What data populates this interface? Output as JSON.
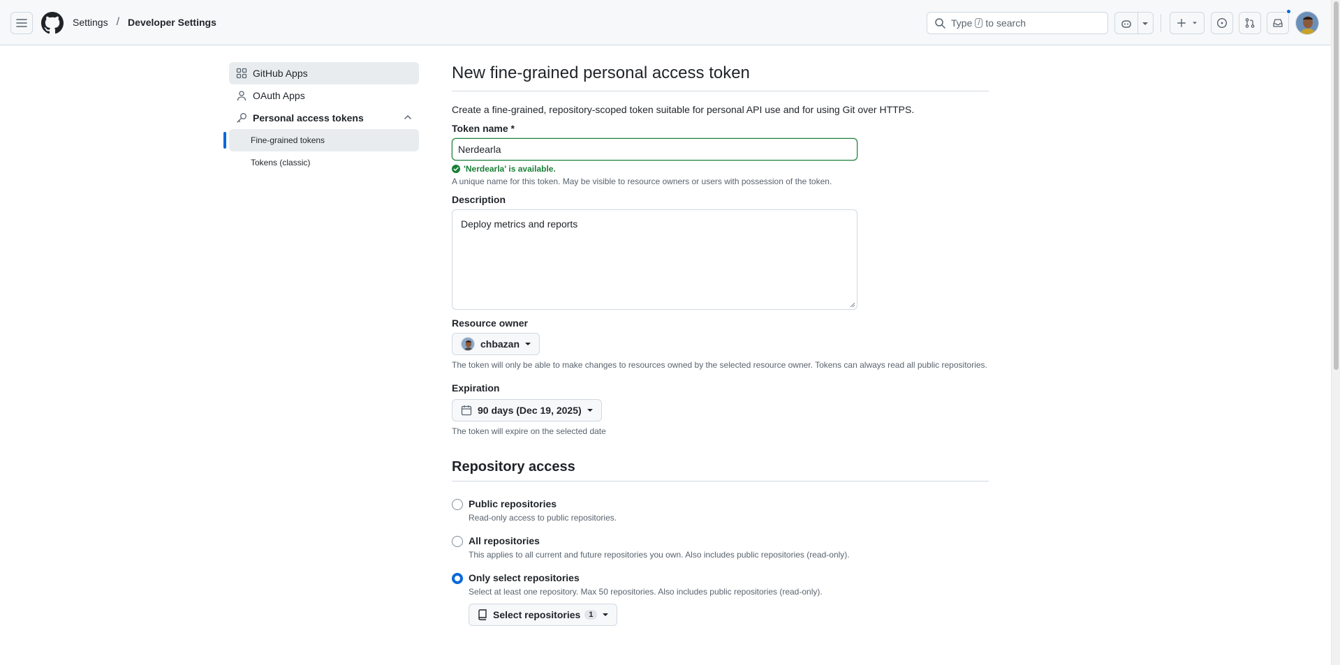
{
  "header": {
    "breadcrumb_settings": "Settings",
    "breadcrumb_sep": "/",
    "breadcrumb_current": "Developer Settings",
    "search_prefix": "Type",
    "search_key": "/",
    "search_suffix": "to search"
  },
  "sidebar": {
    "items": [
      {
        "label": "GitHub Apps",
        "icon": "apps-icon"
      },
      {
        "label": "OAuth Apps",
        "icon": "person-icon"
      },
      {
        "label": "Personal access tokens",
        "icon": "key-icon"
      }
    ],
    "sub_items": [
      {
        "label": "Fine-grained tokens"
      },
      {
        "label": "Tokens (classic)"
      }
    ]
  },
  "main": {
    "title": "New fine-grained personal access token",
    "lead": "Create a fine-grained, repository-scoped token suitable for personal API use and for using Git over HTTPS.",
    "token_name_label": "Token name *",
    "token_name_value": "Nerdearla",
    "token_available": "'Nerdearla' is available.",
    "token_name_hint": "A unique name for this token. May be visible to resource owners or users with possession of the token.",
    "description_label": "Description",
    "description_value": "Deploy metrics and reports",
    "resource_owner_label": "Resource owner",
    "resource_owner_value": "chbazan",
    "resource_owner_hint": "The token will only be able to make changes to resources owned by the selected resource owner. Tokens can always read all public repositories.",
    "expiration_label": "Expiration",
    "expiration_value": "90 days (Dec 19, 2025)",
    "expiration_hint": "The token will expire on the selected date",
    "repo_access_title": "Repository access",
    "repo_options": [
      {
        "label": "Public repositories",
        "hint": "Read-only access to public repositories.",
        "checked": false
      },
      {
        "label": "All repositories",
        "hint": "This applies to all current and future repositories you own. Also includes public repositories (read-only).",
        "checked": false
      },
      {
        "label": "Only select repositories",
        "hint": "Select at least one repository. Max 50 repositories. Also includes public repositories (read-only).",
        "checked": true
      }
    ],
    "select_repos_label": "Select repositories",
    "select_repos_count": "1"
  },
  "colors": {
    "accent": "#0969da",
    "success": "#1a7f37",
    "header_bg": "#f6f8fa"
  }
}
